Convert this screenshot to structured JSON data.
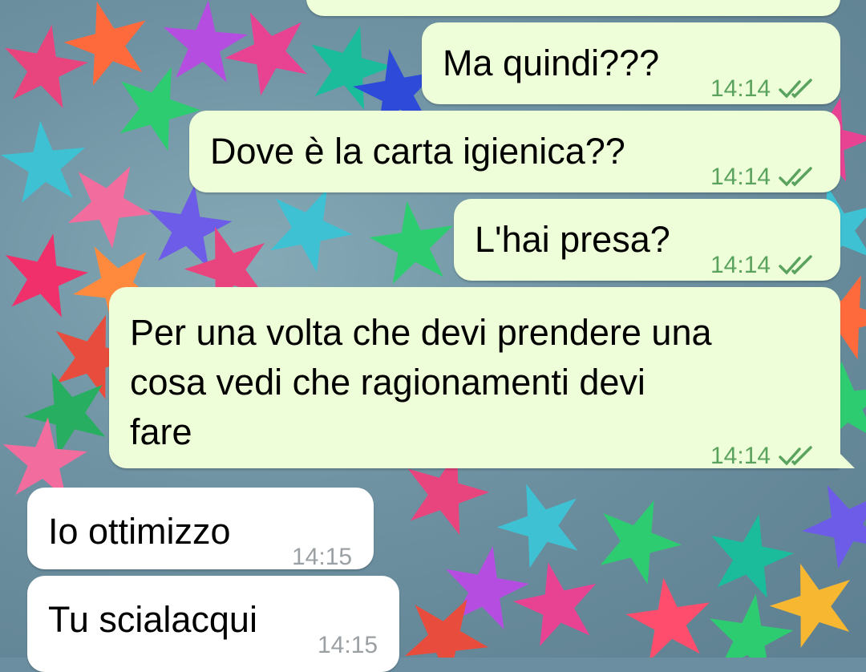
{
  "messages": [
    {
      "text": "",
      "time": "",
      "dir": "out"
    },
    {
      "text": "Ma quindi???",
      "time": "14:14",
      "dir": "out",
      "status": "read-double-check-icon"
    },
    {
      "text": "Dove è la carta igienica??",
      "time": "14:14",
      "dir": "out",
      "status": "read-double-check-icon"
    },
    {
      "text": "L'hai presa?",
      "time": "14:14",
      "dir": "out",
      "status": "read-double-check-icon"
    },
    {
      "lines": [
        "Per una volta che devi prendere una",
        "cosa vedi che ragionamenti devi",
        "fare"
      ],
      "time": "14:14",
      "dir": "out",
      "status": "read-double-check-icon"
    },
    {
      "text": "Io ottimizzo",
      "time": "14:15",
      "dir": "in"
    },
    {
      "text": "Tu scialacqui",
      "time": "14:15",
      "dir": "in"
    }
  ],
  "colors": {
    "outgoing_bubble": "#eefed8",
    "incoming_bubble": "#ffffff",
    "time_out": "#5aa35f",
    "time_in": "#9aa0a3"
  }
}
